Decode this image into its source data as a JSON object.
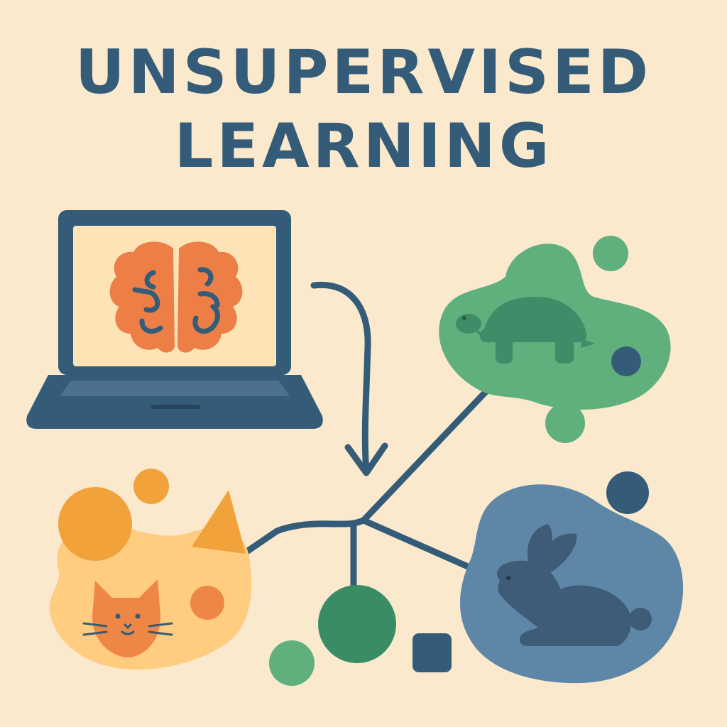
{
  "title": {
    "line1": "UNSUPERVISED",
    "line2": "LEARNING"
  },
  "icons": {
    "laptop": "laptop-icon",
    "brain": "brain-icon",
    "turtle": "turtle-icon",
    "cat": "cat-icon",
    "rabbit": "rabbit-icon",
    "arrow": "curved-arrow-down-icon"
  },
  "colors": {
    "background": "#fbe9cd",
    "navy": "#345c78",
    "brain_orange": "#ec7e46",
    "screen": "#fde3b6",
    "green_cluster": "#5fb07c",
    "turtle_green": "#3f8c68",
    "orange_cluster": "#ffcc80",
    "cat_orange": "#ee8645",
    "orange_dot": "#f2a23b",
    "blue_cluster": "#5e86a6",
    "rabbit_navy": "#3e5c78",
    "node_green": "#3a8c64"
  }
}
